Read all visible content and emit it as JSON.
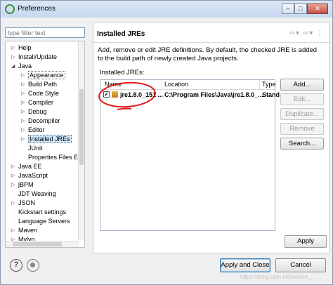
{
  "window": {
    "title": "Preferences"
  },
  "sidebar": {
    "filter_placeholder": "type filter text",
    "items": [
      {
        "label": "Help",
        "arrow": "▷"
      },
      {
        "label": "Install/Update",
        "arrow": "▷"
      },
      {
        "label": "Java",
        "arrow": "◢"
      },
      {
        "label": "Appearance",
        "arrow": "▷"
      },
      {
        "label": "Build Path",
        "arrow": "▷"
      },
      {
        "label": "Code Style",
        "arrow": "▷"
      },
      {
        "label": "Compiler",
        "arrow": "▷"
      },
      {
        "label": "Debug",
        "arrow": "▷"
      },
      {
        "label": "Decompiler",
        "arrow": "▷"
      },
      {
        "label": "Editor",
        "arrow": "▷"
      },
      {
        "label": "Installed JREs",
        "arrow": "▷"
      },
      {
        "label": "JUnit",
        "arrow": ""
      },
      {
        "label": "Properties Files Ec",
        "arrow": ""
      },
      {
        "label": "Java EE",
        "arrow": "▷"
      },
      {
        "label": "JavaScript",
        "arrow": "▷"
      },
      {
        "label": "jBPM",
        "arrow": "▷"
      },
      {
        "label": "JDT Weaving",
        "arrow": ""
      },
      {
        "label": "JSON",
        "arrow": "▷"
      },
      {
        "label": "Kickstart settings",
        "arrow": ""
      },
      {
        "label": "Language Servers",
        "arrow": ""
      },
      {
        "label": "Maven",
        "arrow": "▷"
      },
      {
        "label": "Mylyn",
        "arrow": "▷"
      }
    ]
  },
  "page": {
    "title": "Installed JREs",
    "description": "Add, remove or edit JRE definitions. By default, the checked JRE is added to the build path of newly created Java projects.",
    "installed_label": "Installed JREs:",
    "columns": {
      "name": "Name",
      "location": "Location",
      "type": "Type"
    },
    "rows": [
      {
        "checked": "✓",
        "name": "jre1.8.0_151 ...",
        "location": "C:\\Program Files\\Java\\jre1.8.0_...",
        "type": "Stand"
      }
    ],
    "buttons": {
      "add": "Add...",
      "edit": "Edit...",
      "duplicate": "Duplicate...",
      "remove": "Remove",
      "search": "Search..."
    },
    "apply": "Apply"
  },
  "footer": {
    "apply_close": "Apply and Close",
    "cancel": "Cancel"
  },
  "watermark": "https://blog.csdn.net/weixin_..."
}
